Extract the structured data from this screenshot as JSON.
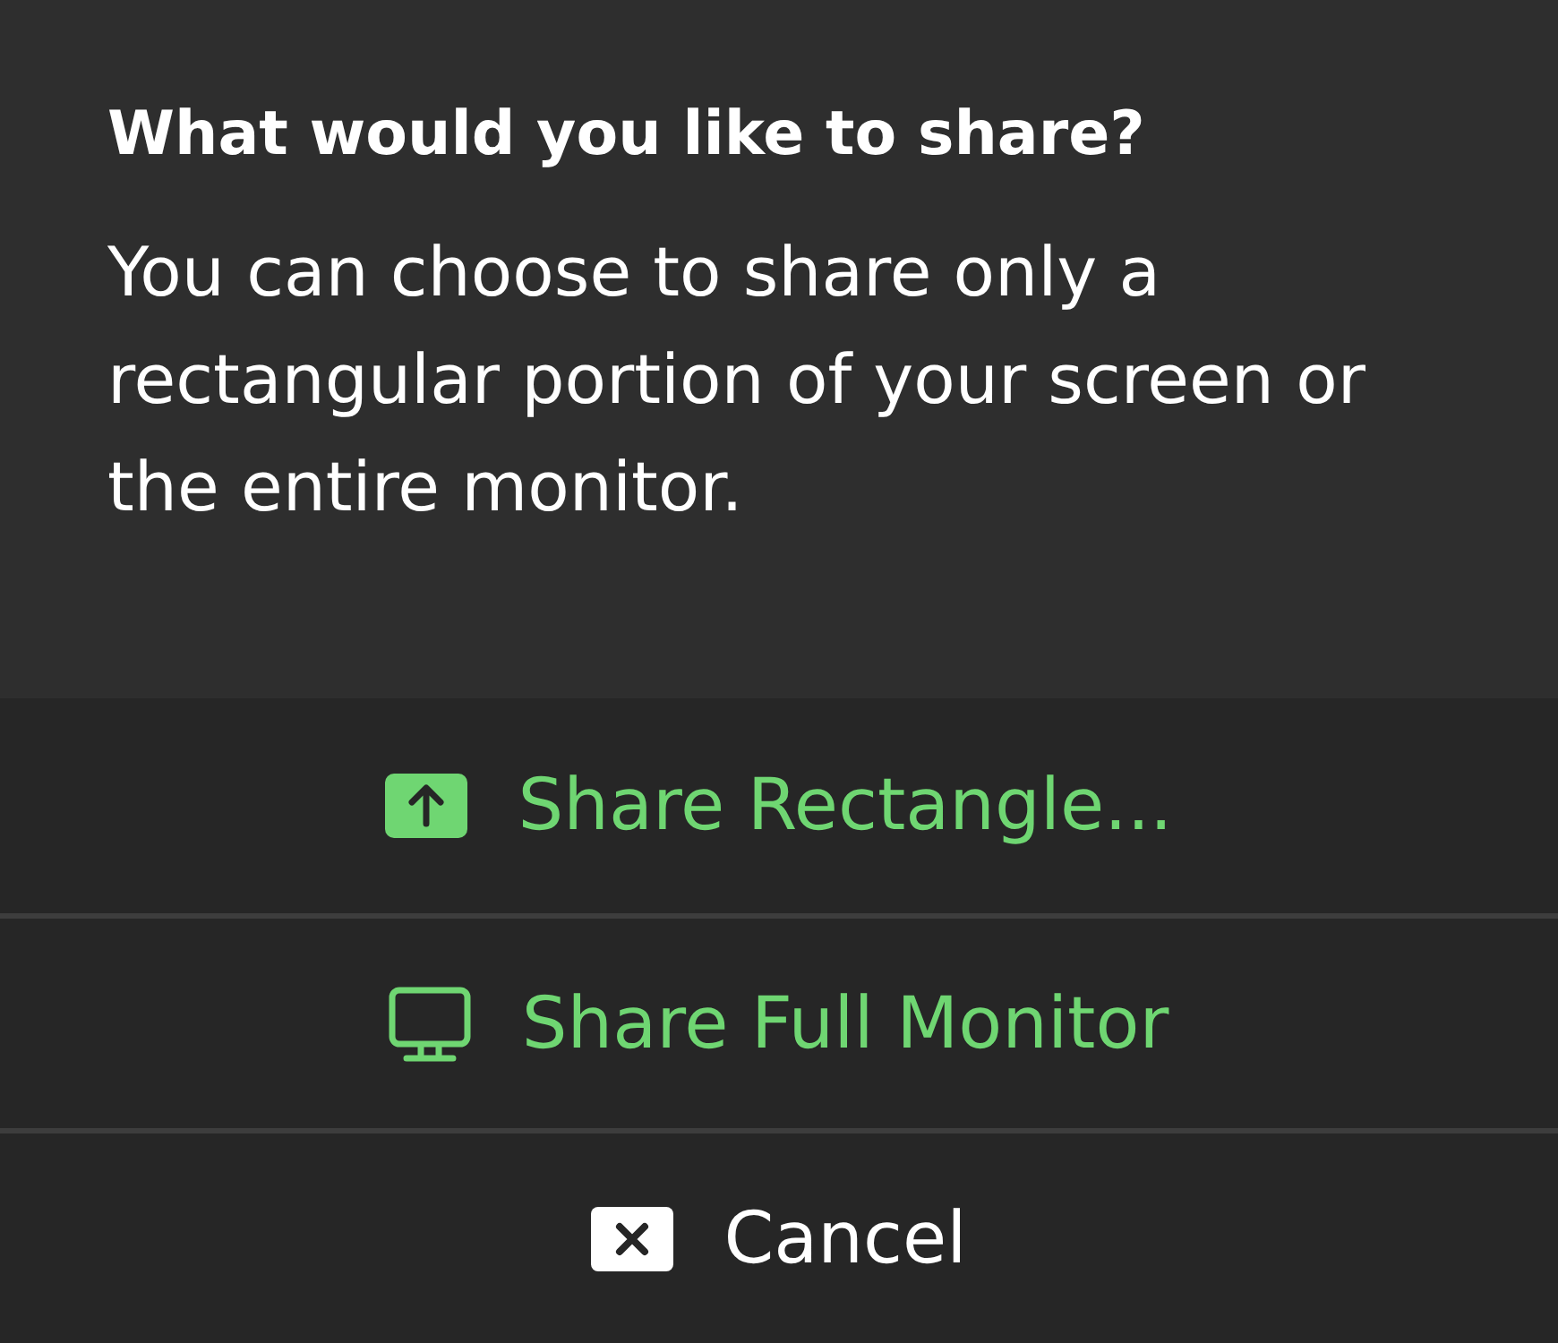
{
  "title": "What would you like to share?",
  "message": "You can choose to share only a rectangular portion of your screen or the entire monitor.",
  "options": [
    {
      "kind": "rectangle",
      "label": "Share Rectangle...",
      "color": "#6fd672"
    },
    {
      "kind": "monitor",
      "label": "Share Full Monitor",
      "color": "#6fd672"
    },
    {
      "kind": "cancel",
      "label": "Cancel",
      "color": "#ffffff"
    }
  ]
}
